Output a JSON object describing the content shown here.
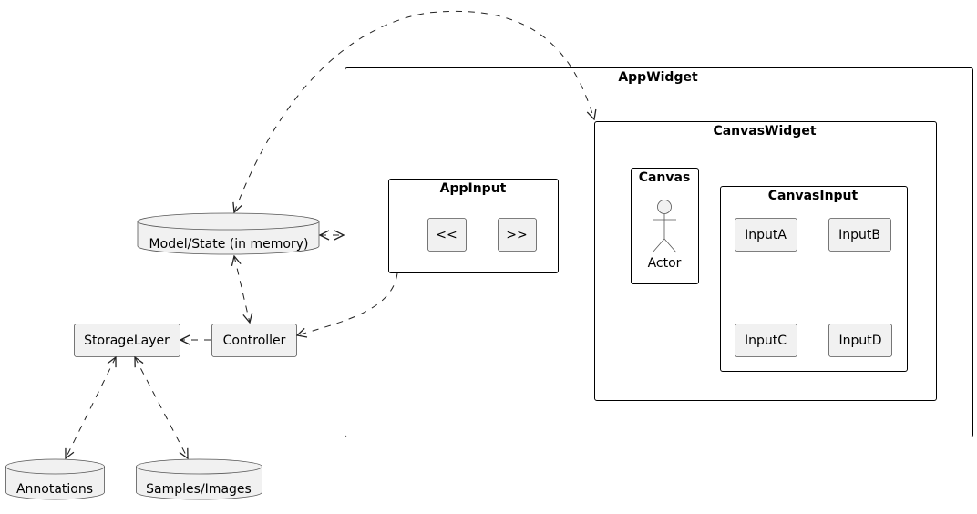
{
  "frames": {
    "app_widget": "AppWidget",
    "canvas_widget": "CanvasWidget",
    "canvas": "Canvas",
    "canvas_input": "CanvasInput",
    "app_input": "AppInput"
  },
  "components": {
    "input_a": "InputA",
    "input_b": "InputB",
    "input_c": "InputC",
    "input_d": "InputD",
    "prev": "<<",
    "next": ">>",
    "storage_layer": "StorageLayer",
    "controller": "Controller"
  },
  "actor": "Actor",
  "databases": {
    "model_state": "Model/State (in memory)",
    "annotations": "Annotations",
    "samples_images": "Samples/Images"
  }
}
